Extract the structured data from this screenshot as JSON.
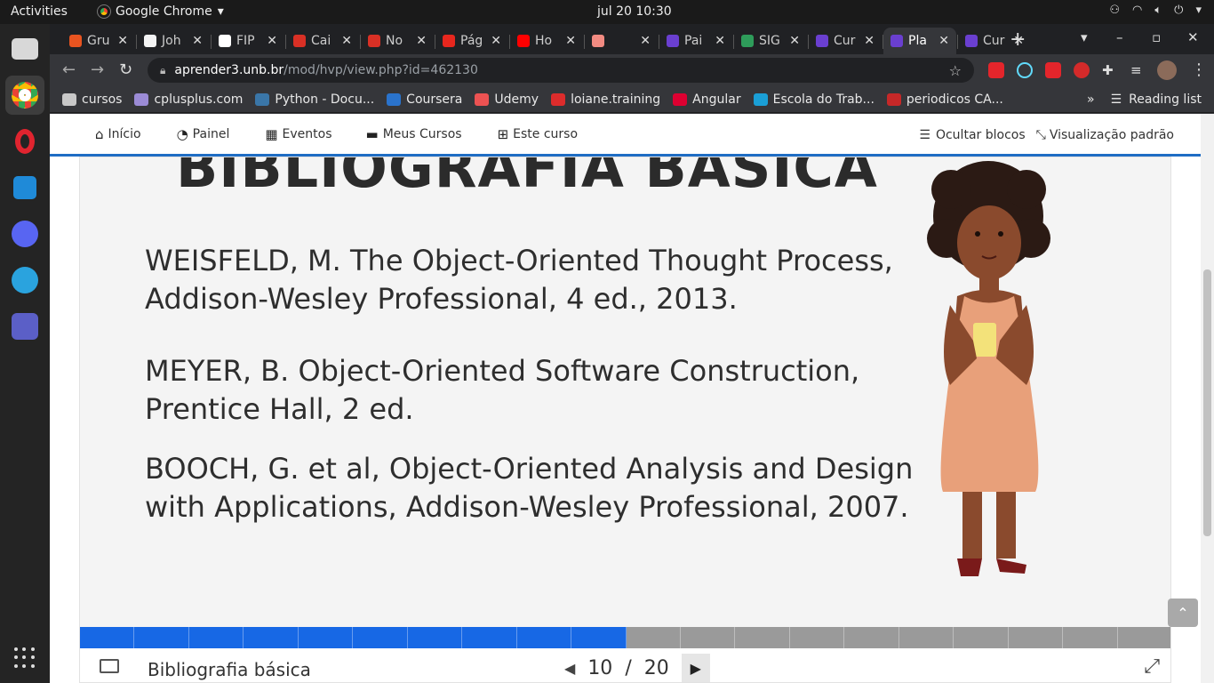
{
  "os": {
    "activities": "Activities",
    "app_name": "Google Chrome",
    "clock": "jul 20  10:30"
  },
  "browser": {
    "tabs": [
      {
        "label": "Gru",
        "color": "#e95420"
      },
      {
        "label": "Joh",
        "color": "#f4f4f4"
      },
      {
        "label": "FIP",
        "color": "#ffffff"
      },
      {
        "label": "Cai",
        "color": "#d93025"
      },
      {
        "label": "No",
        "color": "#d93025"
      },
      {
        "label": "Pág",
        "color": "#e8271e"
      },
      {
        "label": "Ho",
        "color": "#ff0000"
      },
      {
        "label": "",
        "color": "#f28b82"
      },
      {
        "label": "Pai",
        "color": "#6a3fd0"
      },
      {
        "label": "SIG",
        "color": "#2e9c5a"
      },
      {
        "label": "Cur",
        "color": "#6a3fd0"
      },
      {
        "label": "Pla",
        "color": "#6a3fd0"
      },
      {
        "label": "Cur",
        "color": "#6a3fd0"
      }
    ],
    "active_tab_index": 11,
    "url_host": "aprender3.unb.br",
    "url_path": "/mod/hvp/view.php?id=462130",
    "bookmarks": [
      {
        "label": "cursos",
        "color": "#c8c8c8"
      },
      {
        "label": "cplusplus.com",
        "color": "#9b8bd6"
      },
      {
        "label": "Python - Docu...",
        "color": "#3a76a8"
      },
      {
        "label": "Coursera",
        "color": "#2a73cc"
      },
      {
        "label": "Udemy",
        "color": "#ec5252"
      },
      {
        "label": "loiane.training",
        "color": "#dd2c2c"
      },
      {
        "label": "Angular",
        "color": "#dd0031"
      },
      {
        "label": "Escola do Trab...",
        "color": "#1a9fd6"
      },
      {
        "label": "periodicos CA...",
        "color": "#c62828"
      }
    ],
    "bookmarks_more": "»",
    "reading_list": "Reading list"
  },
  "moodle": {
    "nav": [
      {
        "label": "Início",
        "icon": "home-icon",
        "glyph": "⌂"
      },
      {
        "label": "Painel",
        "icon": "dashboard-icon",
        "glyph": "◔"
      },
      {
        "label": "Eventos",
        "icon": "calendar-icon",
        "glyph": "▦"
      },
      {
        "label": "Meus Cursos",
        "icon": "briefcase-icon",
        "glyph": "▬"
      },
      {
        "label": "Este curso",
        "icon": "sitemap-icon",
        "glyph": "⊞"
      }
    ],
    "hide_blocks": "Ocultar blocos",
    "default_view": "Visualização padrão"
  },
  "slide": {
    "title": "BIBLIOGRAFIA BÁSICA",
    "references": [
      "WEISFELD, M. The Object-Oriented Thought Process, Addison-Wesley Professional, 4 ed., 2013.",
      "MEYER, B. Object-Oriented Software Construction, Prentice Hall, 2 ed.",
      "BOOCH, G. et al, Object-Oriented Analysis and Design with Applications, Addison-Wesley Professional, 2007."
    ],
    "current_slide_label": "Bibliografia básica",
    "current": "10",
    "separator": "/",
    "total": "20",
    "progress_done_color": "#1768e5",
    "progress_todo_color": "#9a9a9a"
  }
}
